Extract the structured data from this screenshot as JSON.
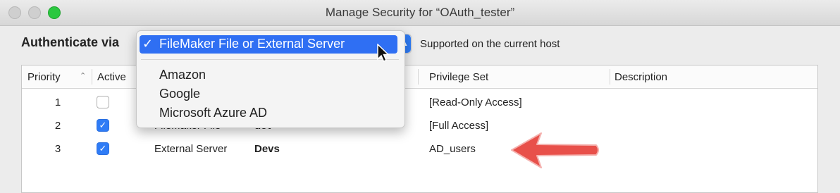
{
  "window": {
    "title": "Manage Security for “OAuth_tester”"
  },
  "auth": {
    "label": "Authenticate via",
    "selected": "FileMaker File or External Server",
    "status": "Supported on the current host"
  },
  "menu": {
    "check": "✓",
    "selected_label": "FileMaker File or External Server",
    "items": [
      "Amazon",
      "Google",
      "Microsoft Azure AD"
    ]
  },
  "table": {
    "headers": {
      "priority": "Priority",
      "active": "Active",
      "privilege": "Privilege Set",
      "description": "Description"
    },
    "rows": [
      {
        "priority": "1",
        "active": false,
        "type": "",
        "account": "",
        "privilege": "[Read-Only Access]"
      },
      {
        "priority": "2",
        "active": true,
        "type": "FileMaker File",
        "account": "dev",
        "privilege": "[Full Access]"
      },
      {
        "priority": "3",
        "active": true,
        "type": "External Server",
        "account": "Devs",
        "privilege": "AD_users"
      }
    ]
  },
  "colors": {
    "accent": "#2f6ff3",
    "annotation_arrow": "#e8504a"
  }
}
